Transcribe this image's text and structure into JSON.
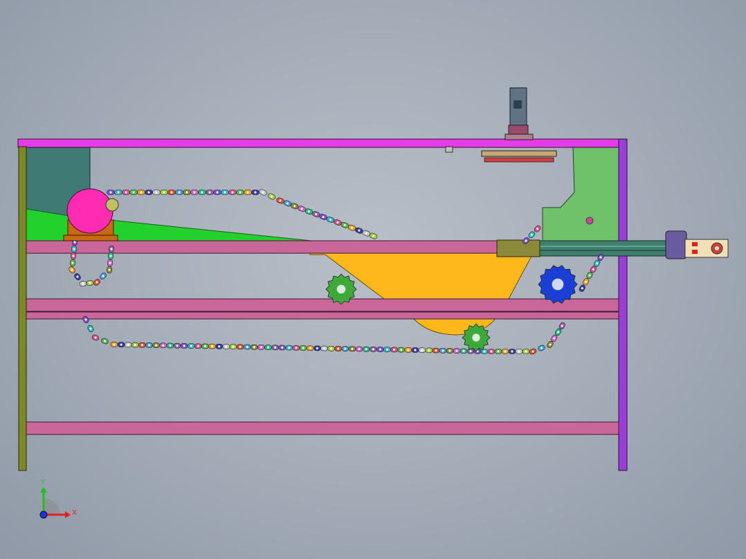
{
  "view": {
    "background_top": "#b9bfc8",
    "background_bottom": "#8f99a7"
  },
  "colors": {
    "frame_top_beam": "#e43ce6",
    "frame_post_left": "#7b8a27",
    "frame_post_right": "#9a3fd6",
    "cross_beam": "#c9679a",
    "side_plate_left": "#3f7a74",
    "green_wedge": "#22d12b",
    "right_bracket": "#6fc26a",
    "hopper": "#ffb81c",
    "motor": "#ff2bb0",
    "motor_base": "#c86a14",
    "sprocket_green": "#3fa83a",
    "sprocket_blue": "#1b3fd6",
    "conveyor_rail": "#3f7f6e",
    "cylinder": "#5f7384"
  },
  "chain_link_colors": [
    "#7a4ed4",
    "#2fb8c0",
    "#d84f8f",
    "#56b84a",
    "#f0a020",
    "#3a3aa8",
    "#c8c8c8",
    "#a0d040",
    "#e05030",
    "#40a0e0",
    "#8a8a30",
    "#d060d0",
    "#20c080",
    "#9060a0"
  ],
  "triad": {
    "x_label": "X",
    "y_label": "Y",
    "x_color": "#e02020",
    "y_color": "#20c020",
    "origin_color": "#2030e0"
  }
}
